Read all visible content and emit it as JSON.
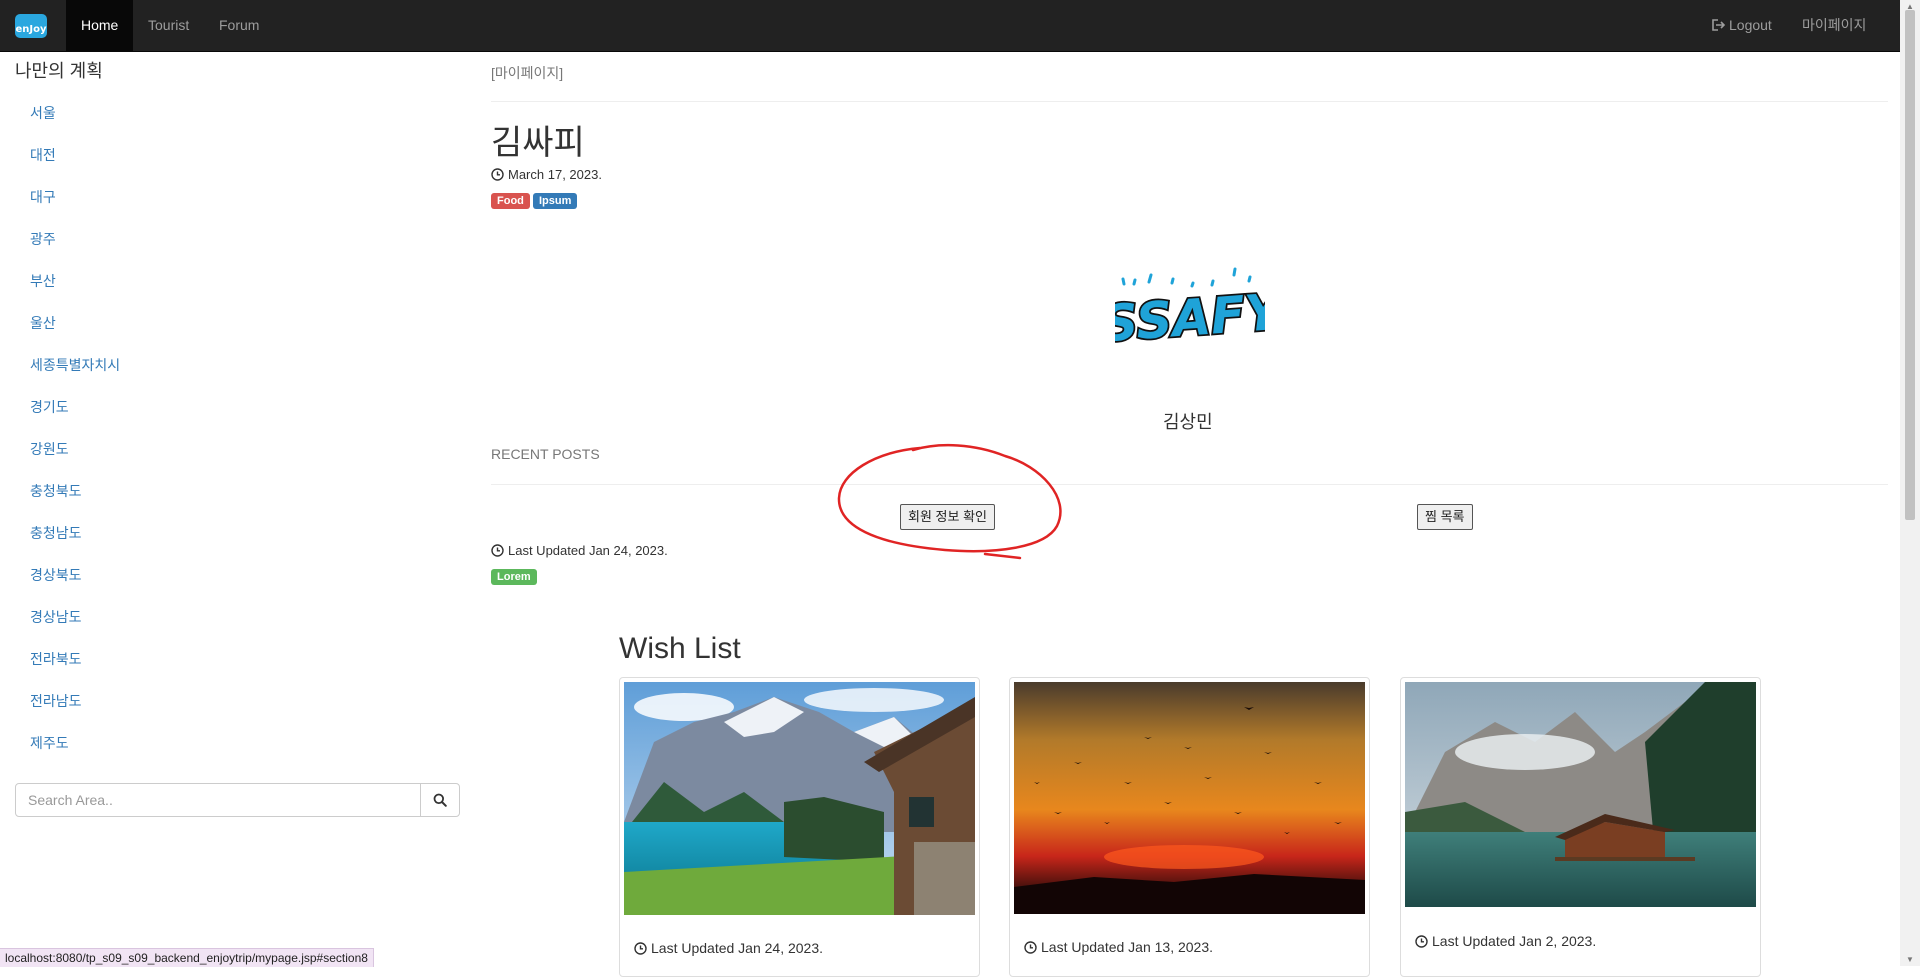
{
  "navbar": {
    "brand_text": "enJoy",
    "tabs": [
      {
        "label": "Home",
        "active": true
      },
      {
        "label": "Tourist",
        "active": false
      },
      {
        "label": "Forum",
        "active": false
      }
    ],
    "logout_label": "Logout",
    "mypage_label": "마이페이지"
  },
  "sidebar": {
    "title": "나만의 계획",
    "regions": [
      "서울",
      "대전",
      "대구",
      "광주",
      "부산",
      "울산",
      "세종특별자치시",
      "경기도",
      "강원도",
      "충청북도",
      "충청남도",
      "경상북도",
      "경상남도",
      "전라북도",
      "전라남도",
      "제주도"
    ],
    "search_placeholder": "Search Area.."
  },
  "main": {
    "breadcrumb": "[마이페이지]",
    "profile_name": "김싸피",
    "profile_date": "March 17, 2023.",
    "tags": [
      {
        "text": "Food",
        "color": "#d9534f"
      },
      {
        "text": "Ipsum",
        "color": "#337ab7"
      }
    ],
    "logo_text": "SSAFY",
    "member_name": "김상민",
    "recent_posts_heading": "RECENT POSTS",
    "member_info_button": "회원 정보 확인",
    "wishlist_button": "찜 목록",
    "recent_updated": "Last Updated Jan 24, 2023.",
    "recent_tag": {
      "text": "Lorem",
      "color": "#5cb85c"
    }
  },
  "wish_list": {
    "title": "Wish List",
    "cards": [
      {
        "image": "mountain-lake-chalet",
        "updated": "Last Updated Jan 24, 2023."
      },
      {
        "image": "sunset-birds",
        "updated": "Last Updated Jan 13, 2023."
      },
      {
        "image": "lake-boathouse",
        "updated": "Last Updated Jan 2, 2023."
      }
    ]
  },
  "status_bar": {
    "url": "localhost:8080/tp_s09_s09_backend_enjoytrip/mypage.jsp#section8"
  },
  "colors": {
    "navbar_bg": "#222222",
    "link": "#337ab7",
    "annotation": "#e02424"
  }
}
